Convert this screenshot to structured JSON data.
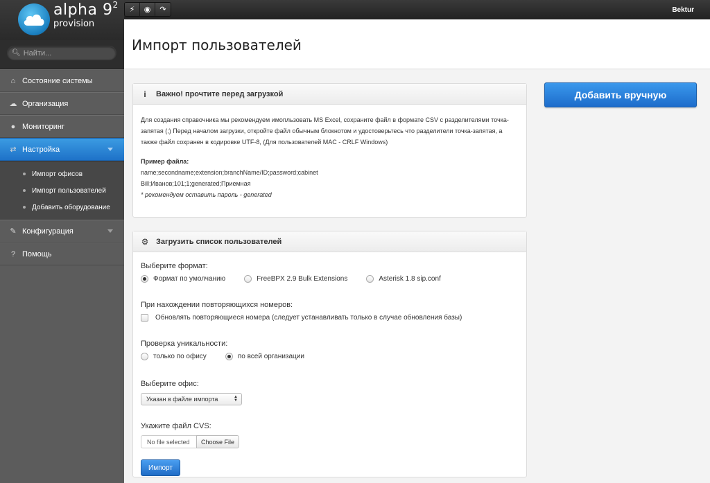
{
  "logo": {
    "name": "alpha 9",
    "superscript": "2",
    "sub": "provision"
  },
  "toolbar": {
    "icons": [
      "lightning-icon",
      "eye-icon",
      "redo-icon"
    ]
  },
  "user": {
    "name": "Bektur"
  },
  "search": {
    "placeholder": "Найти..."
  },
  "sidebar": {
    "items": [
      {
        "label": "Состояние системы",
        "icon": "home-icon"
      },
      {
        "label": "Организация",
        "icon": "cloud-icon"
      },
      {
        "label": "Мониторинг",
        "icon": "location-icon"
      },
      {
        "label": "Настройка",
        "icon": "shuffle-icon",
        "active": true
      },
      {
        "label": "Конфигурация",
        "icon": "wrench-icon"
      },
      {
        "label": "Помощь",
        "icon": "question-icon"
      }
    ],
    "subitems": [
      {
        "label": "Импорт офисов"
      },
      {
        "label": "Импорт пользователей"
      },
      {
        "label": "Добавить оборудование"
      }
    ]
  },
  "page": {
    "title": "Импорт пользователей"
  },
  "info_panel": {
    "title": "Важно! прочтите перед загрузкой",
    "description": "Для создания справочника мы рекомендуем имопльзовать MS Excel, сохраните файл в формате CSV с разделителями точка-запятая (;) Перед началом загрузки, откройте файл обычным блокнотом и удостоверьтесь что разделители точка-запятая, а также файл сохранен в кодировке UTF-8, (Для пользователей MAC - CRLF Windows)",
    "example_label": "Пример файла:",
    "example_line1": "name;secondname;extension;branchName/ID;password;cabinet",
    "example_line2": "Bill;Иванов;101;1;generated;Приемная",
    "note": "* рекомендуем оставить пароль - generated"
  },
  "upload_panel": {
    "title": "Загрузить список пользователей",
    "format_label": "Выберите формат:",
    "format_options": [
      {
        "label": "Формат по умолчанию",
        "selected": true
      },
      {
        "label": "FreeBPX 2.9 Bulk Extensions",
        "selected": false
      },
      {
        "label": "Asterisk 1.8 sip.conf",
        "selected": false
      }
    ],
    "duplicates_label": "При нахождении повторяющихся номеров:",
    "duplicates_checkbox": "Обновлять повторяющиеся номера (следует устанавливать только в случае обновления базы)",
    "uniqueness_label": "Проверка уникальности:",
    "uniqueness_options": [
      {
        "label": "только по офису",
        "selected": false
      },
      {
        "label": "по всей организации",
        "selected": true
      }
    ],
    "office_label": "Выберите офис:",
    "office_selected": "Указан в файле импорта",
    "file_label": "Укажите файл CVS:",
    "file_name": "No file selected",
    "file_button": "Choose File",
    "import_button": "Импорт"
  },
  "add_button": "Добавить вручную"
}
